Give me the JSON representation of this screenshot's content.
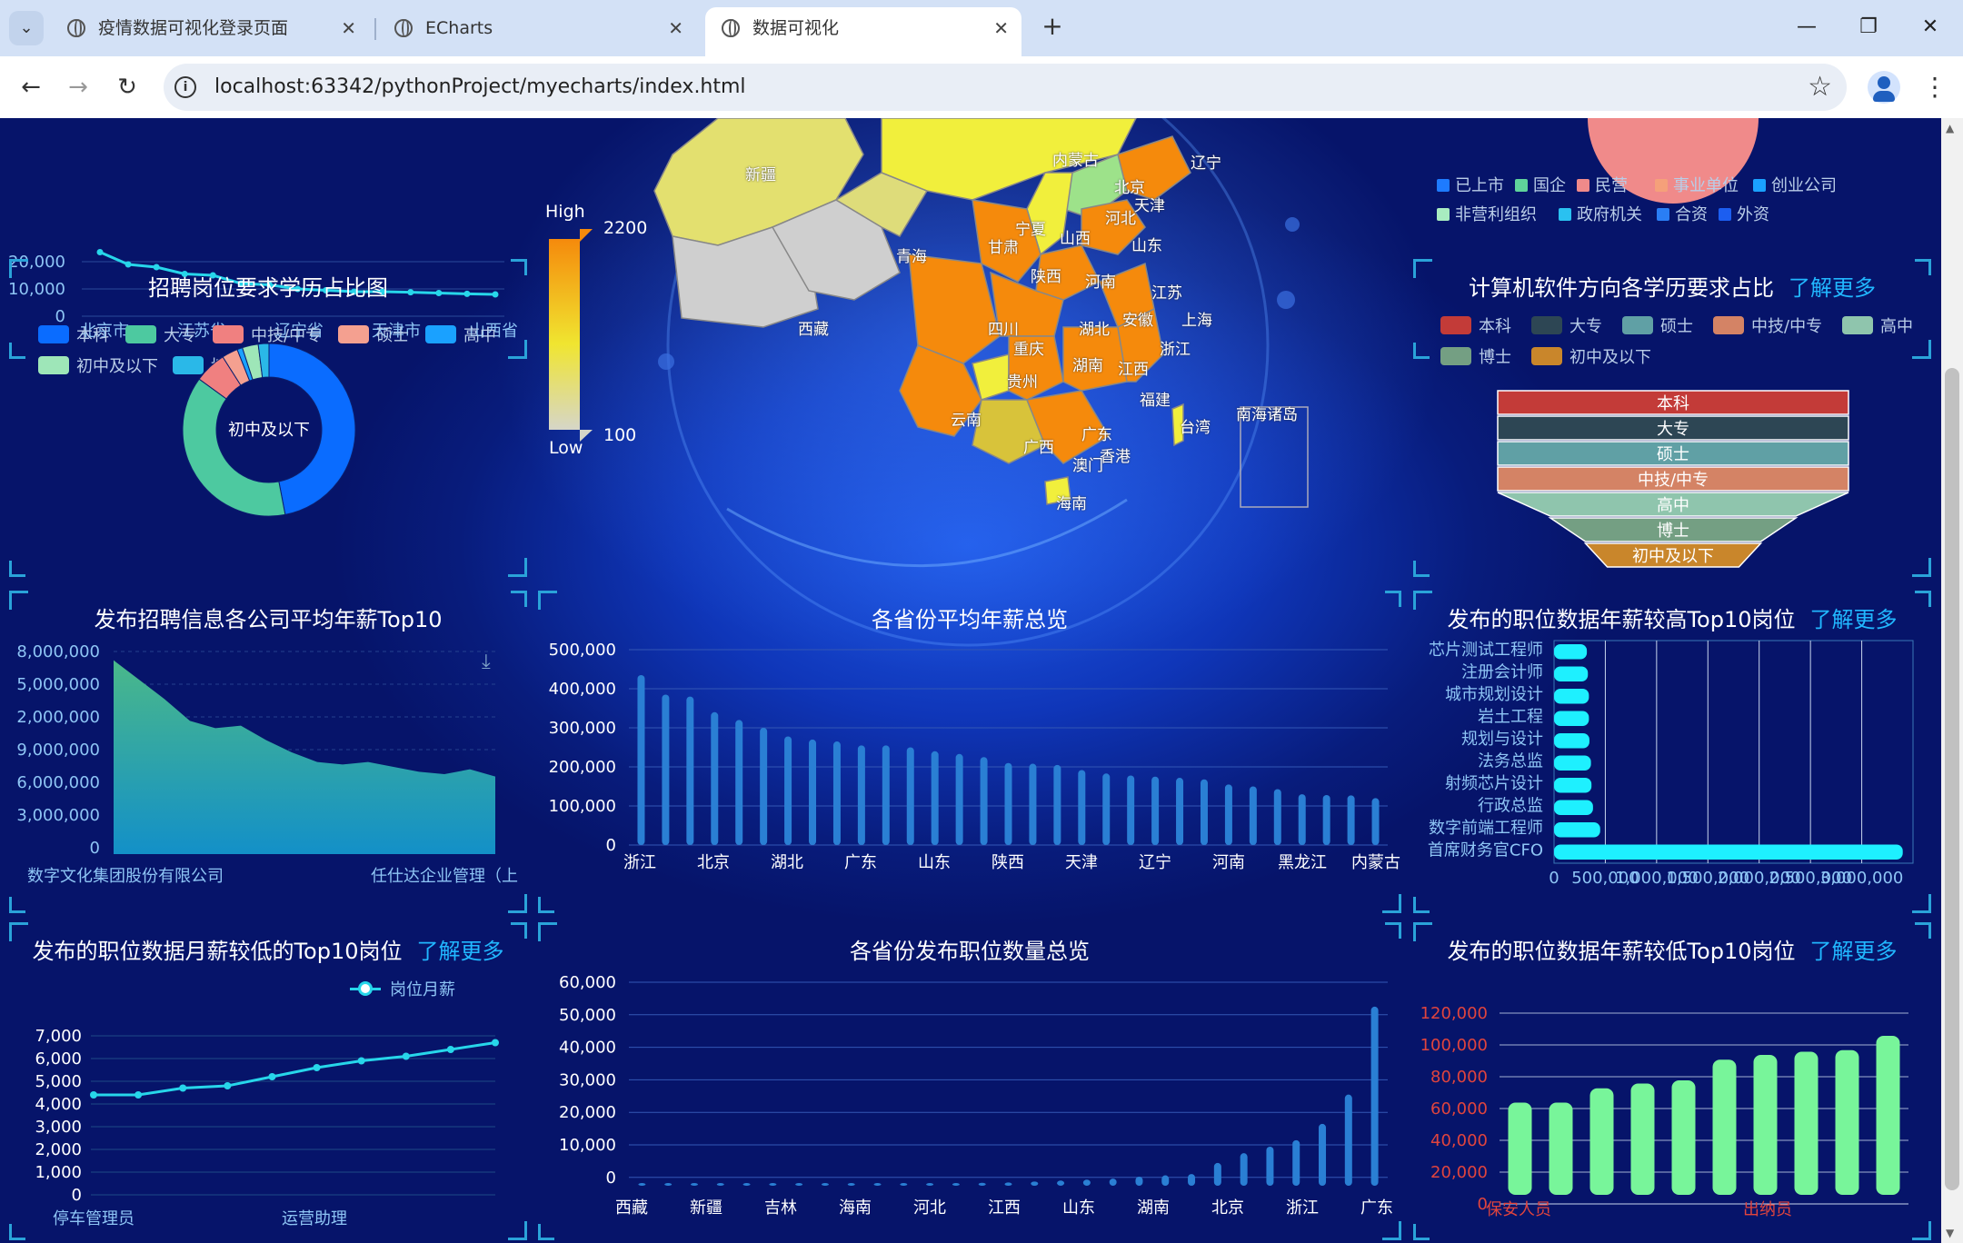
{
  "browser": {
    "tabs": [
      {
        "title": "疫情数据可视化登录页面",
        "active": false
      },
      {
        "title": "ECharts",
        "active": false
      },
      {
        "title": "数据可视化",
        "active": true
      }
    ],
    "url": "localhost:63342/pythonProject/myecharts/index.html",
    "window_controls": {
      "minimize": "—",
      "restore": "❐",
      "close": "✕"
    }
  },
  "panels": {
    "top_left_line": {
      "y_ticks": [
        "20,000",
        "10,000",
        "0"
      ],
      "x_labels": [
        "北京市",
        "江苏省",
        "辽宁省",
        "天津市",
        "山西省"
      ]
    },
    "education_pie": {
      "title": "招聘岗位要求学历占比图",
      "legend": [
        {
          "name": "本科",
          "color": "#0a6cff"
        },
        {
          "name": "大专",
          "color": "#4dc9a0"
        },
        {
          "name": "中技/中专",
          "color": "#f08080"
        },
        {
          "name": "硕士",
          "color": "#f4a090"
        },
        {
          "name": "高中",
          "color": "#1aa1ff"
        },
        {
          "name": "初中及以下",
          "color": "#9ee6b8"
        },
        {
          "name": "博士",
          "color": "#2ab8e8"
        }
      ],
      "center_label": "初中及以下",
      "overlay_label": "博士"
    },
    "map": {
      "visual_map": {
        "high_label": "High",
        "low_label": "Low",
        "max": "2200",
        "min": "100"
      },
      "regions": [
        "新疆",
        "内蒙古",
        "辽宁",
        "北京",
        "天津",
        "河北",
        "山西",
        "山东",
        "宁夏",
        "甘肃",
        "青海",
        "西藏",
        "陕西",
        "河南",
        "江苏",
        "上海",
        "安徽",
        "湖北",
        "四川",
        "重庆",
        "浙江",
        "湖南",
        "江西",
        "贵州",
        "福建",
        "云南",
        "广西",
        "广东",
        "台湾",
        "香港",
        "澳门",
        "海南",
        "南海诸岛"
      ]
    },
    "top_right_pie": {
      "legend": [
        {
          "name": "已上市",
          "color": "#1e7bff"
        },
        {
          "name": "国企",
          "color": "#5fd39b"
        },
        {
          "name": "民营",
          "color": "#f08a8a"
        },
        {
          "name": "事业单位",
          "color": "#f5a07a"
        },
        {
          "name": "创业公司",
          "color": "#1aa1ff"
        },
        {
          "name": "非营利组织",
          "color": "#a8ecc0"
        },
        {
          "name": "政府机关",
          "color": "#2ac1f0"
        },
        {
          "name": "合资",
          "color": "#2a7ef5"
        },
        {
          "name": "外资",
          "color": "#1c5ef0"
        }
      ]
    },
    "cs_funnel": {
      "title": "计算机软件方向各学历要求占比",
      "more": "了解更多",
      "legend": [
        {
          "name": "本科",
          "color": "#c33b38"
        },
        {
          "name": "大专",
          "color": "#2d4654"
        },
        {
          "name": "硕士",
          "color": "#60a0a5"
        },
        {
          "name": "中技/中专",
          "color": "#d48365"
        },
        {
          "name": "高中",
          "color": "#8fc5ad"
        },
        {
          "name": "博士",
          "color": "#749f83"
        },
        {
          "name": "初中及以下",
          "color": "#c9862b"
        }
      ],
      "levels": [
        "本科",
        "大专",
        "硕士",
        "中技/中专",
        "高中",
        "博士",
        "初中及以下"
      ]
    },
    "company_salary": {
      "title": "发布招聘信息各公司平均年薪Top10",
      "y_ticks": [
        "8,000,000",
        "5,000,000",
        "2,000,000",
        "9,000,000",
        "6,000,000",
        "3,000,000",
        "0"
      ],
      "x_labels": [
        "数字文化集团股份有限公司",
        "任仕达企业管理（上"
      ]
    },
    "province_salary": {
      "title": "各省份平均年薪总览",
      "y_ticks": [
        "500,000",
        "400,000",
        "300,000",
        "200,000",
        "100,000",
        "0"
      ],
      "x_labels": [
        "浙江",
        "北京",
        "湖北",
        "广东",
        "山东",
        "陕西",
        "天津",
        "辽宁",
        "河南",
        "黑龙江",
        "内蒙古"
      ]
    },
    "top_salary_jobs": {
      "title": "发布的职位数据年薪较高Top10岗位",
      "more": "了解更多",
      "jobs": [
        "芯片测试工程师",
        "注册会计师",
        "城市规划设计",
        "岩土工程",
        "规划与设计",
        "法务总监",
        "射频芯片设计",
        "行政总监",
        "数字前端工程师",
        "首席财务官CFO"
      ],
      "x_ticks": [
        "0",
        "500,000",
        "1,000,000",
        "1,500,000",
        "2,000,000",
        "2,500,000",
        "3,000,000"
      ]
    },
    "low_month_salary": {
      "title": "发布的职位数据月薪较低的Top10岗位",
      "more": "了解更多",
      "legend": "岗位月薪",
      "y_ticks": [
        "7,000",
        "6,000",
        "5,000",
        "4,000",
        "3,000",
        "2,000",
        "1,000",
        "0"
      ],
      "x_labels": [
        "停车管理员",
        "运营助理"
      ]
    },
    "province_jobs": {
      "title": "各省份发布职位数量总览",
      "y_ticks": [
        "60,000",
        "50,000",
        "40,000",
        "30,000",
        "20,000",
        "10,000",
        "0"
      ],
      "x_labels": [
        "西藏",
        "新疆",
        "吉林",
        "海南",
        "河北",
        "江西",
        "山东",
        "湖南",
        "北京",
        "浙江",
        "广东"
      ]
    },
    "low_year_salary": {
      "title": "发布的职位数据年薪较低Top10岗位",
      "more": "了解更多",
      "y_ticks": [
        "120,000",
        "100,000",
        "80,000",
        "60,000",
        "40,000",
        "20,000",
        "0"
      ],
      "x_labels": [
        "保安人员",
        "出纳员"
      ]
    }
  },
  "chart_data": [
    {
      "type": "line",
      "series": [
        {
          "values": [
            23500,
            19000,
            18000,
            15500,
            15000,
            12000,
            11500,
            10000,
            9500,
            9000,
            9000,
            8800,
            8500,
            8200,
            8000
          ]
        }
      ],
      "ylim": [
        0,
        20000
      ]
    },
    {
      "type": "pie",
      "title": "招聘岗位要求学历占比图",
      "categories": [
        "本科",
        "大专",
        "中技/中专",
        "硕士",
        "高中",
        "初中及以下",
        "博士"
      ],
      "values": [
        47,
        38,
        6,
        3,
        1,
        3,
        2
      ]
    },
    {
      "type": "funnel",
      "title": "计算机软件方向各学历要求占比",
      "categories": [
        "本科",
        "大专",
        "硕士",
        "中技/中专",
        "高中",
        "博士",
        "初中及以下"
      ],
      "values": [
        100,
        100,
        100,
        100,
        100,
        70,
        50
      ]
    },
    {
      "type": "area",
      "title": "发布招聘信息各公司平均年薪Top10",
      "values": [
        8000000,
        7200000,
        6400000,
        5500000,
        5200000,
        5300000,
        4700000,
        4200000,
        3800000,
        3700000,
        3800000,
        3600000,
        3400000,
        3300000,
        3500000,
        3200000
      ],
      "ylim": [
        0,
        9000000
      ]
    },
    {
      "type": "bar",
      "title": "各省份平均年薪总览",
      "values": [
        435000,
        385000,
        380000,
        340000,
        320000,
        300000,
        278000,
        270000,
        265000,
        255000,
        255000,
        250000,
        240000,
        233000,
        225000,
        210000,
        208000,
        205000,
        192000,
        183000,
        178000,
        175000,
        172000,
        168000,
        155000,
        150000,
        143000,
        130000,
        128000,
        127000,
        120000
      ],
      "ylim": [
        0,
        500000
      ]
    },
    {
      "type": "bar",
      "title": "发布的职位数据年薪较高Top10岗位",
      "categories": [
        "芯片测试工程师",
        "注册会计师",
        "城市规划设计",
        "岩土工程",
        "规划与设计",
        "法务总监",
        "射频芯片设计",
        "行政总监",
        "数字前端工程师",
        "首席财务官CFO"
      ],
      "values": [
        320000,
        330000,
        340000,
        340000,
        345000,
        360000,
        365000,
        380000,
        450000,
        3400000
      ],
      "xlim": [
        0,
        3500000
      ]
    },
    {
      "type": "line",
      "title": "发布的职位数据月薪较低的Top10岗位",
      "series": [
        {
          "name": "岗位月薪",
          "values": [
            4400,
            4400,
            4700,
            4800,
            5200,
            5600,
            5900,
            6100,
            6400,
            6700
          ]
        }
      ],
      "ylim": [
        0,
        7000
      ]
    },
    {
      "type": "bar",
      "title": "各省份发布职位数量总览",
      "values": [
        60,
        100,
        150,
        200,
        250,
        300,
        350,
        400,
        450,
        500,
        600,
        700,
        800,
        900,
        1000,
        1300,
        1600,
        1900,
        2200,
        2800,
        3200,
        3600,
        7000,
        10000,
        12000,
        14000,
        19000,
        28000,
        55000
      ],
      "ylim": [
        0,
        60000
      ]
    },
    {
      "type": "bar",
      "title": "发布的职位数据年薪较低Top10岗位",
      "values": [
        58000,
        58000,
        67000,
        70000,
        72000,
        85000,
        88000,
        90000,
        91000,
        100000
      ],
      "ylim": [
        0,
        120000
      ]
    }
  ]
}
